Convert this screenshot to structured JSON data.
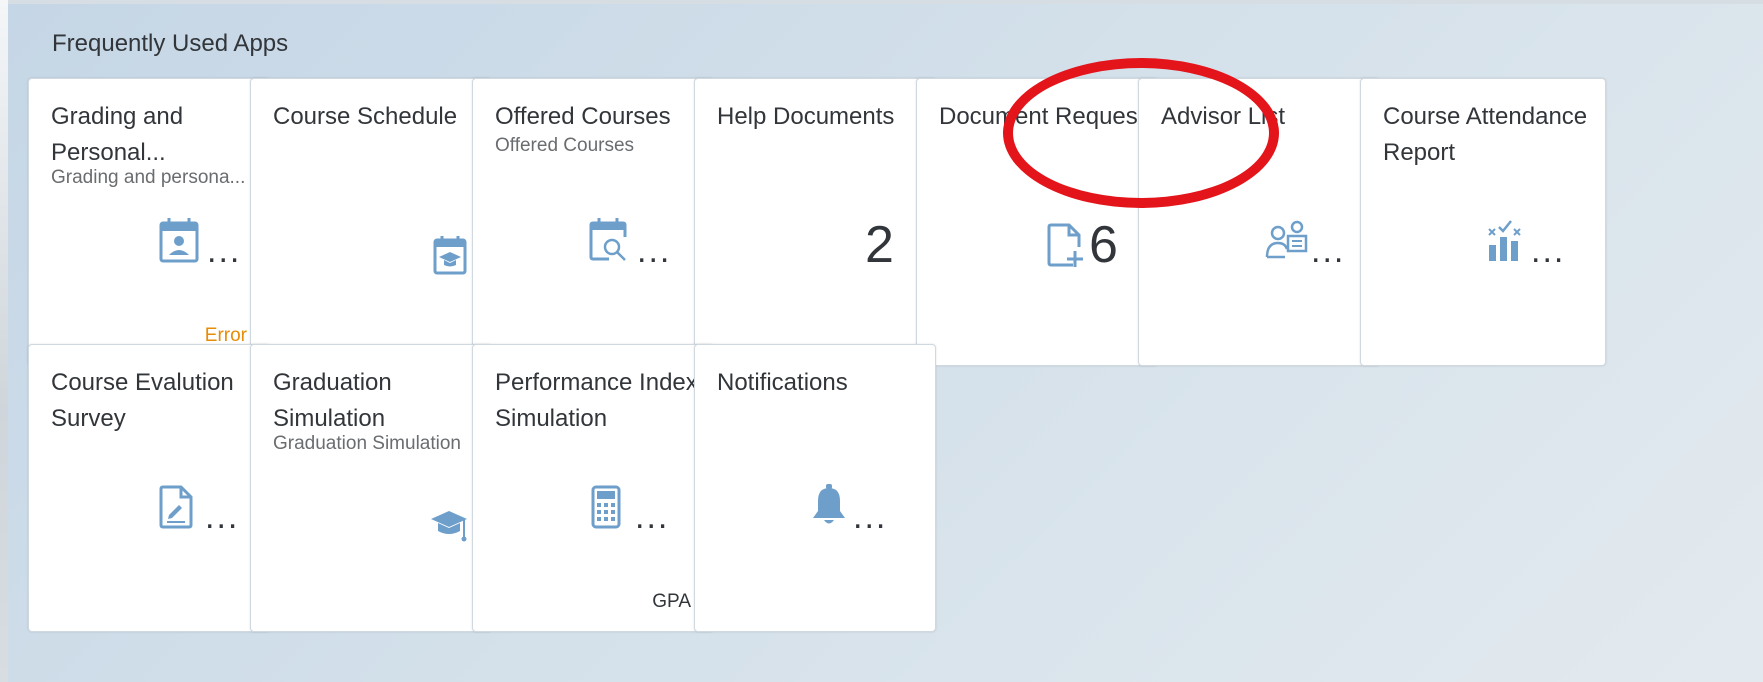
{
  "section": {
    "title": "Frequently Used Apps"
  },
  "tiles": [
    {
      "title": "Grading and Personal...",
      "subtitle": "Grading and persona...",
      "icon": "calendar-person-icon",
      "footer": "Error",
      "more": "..."
    },
    {
      "title": "Course Schedule",
      "subtitle": "",
      "icon": "calendar-graduation-icon",
      "footer": "",
      "more": ""
    },
    {
      "title": "Offered Courses",
      "subtitle": "Offered Courses",
      "icon": "calendar-search-icon",
      "footer": "",
      "more": "..."
    },
    {
      "title": "Help Documents",
      "subtitle": "",
      "icon": "",
      "footer": "",
      "value": "2"
    },
    {
      "title": "Document Request",
      "subtitle": "",
      "icon": "document-add-icon",
      "footer": "",
      "value": "6"
    },
    {
      "title": "Advisor List",
      "subtitle": "",
      "icon": "person-list-icon",
      "footer": "",
      "more": "..."
    },
    {
      "title": "Course Attendance Report",
      "subtitle": "",
      "icon": "bar-chart-check-icon",
      "footer": "",
      "more": "..."
    },
    {
      "title": "Course Evalution Survey",
      "subtitle": "",
      "icon": "survey-edit-icon",
      "footer": "",
      "more": "..."
    },
    {
      "title": "Graduation Simulation",
      "subtitle": "Graduation Simulation",
      "icon": "graduation-cap-icon",
      "footer": "",
      "more": ""
    },
    {
      "title": "Performance Index Simulation",
      "subtitle": "",
      "icon": "calculator-icon",
      "footer": "GPA",
      "more": "..."
    },
    {
      "title": "Notifications",
      "subtitle": "",
      "icon": "bell-icon",
      "footer": "",
      "more": "..."
    }
  ],
  "colors": {
    "icon": "#6e9fcb",
    "highlight": "#e4141b",
    "error": "#e78c07"
  }
}
